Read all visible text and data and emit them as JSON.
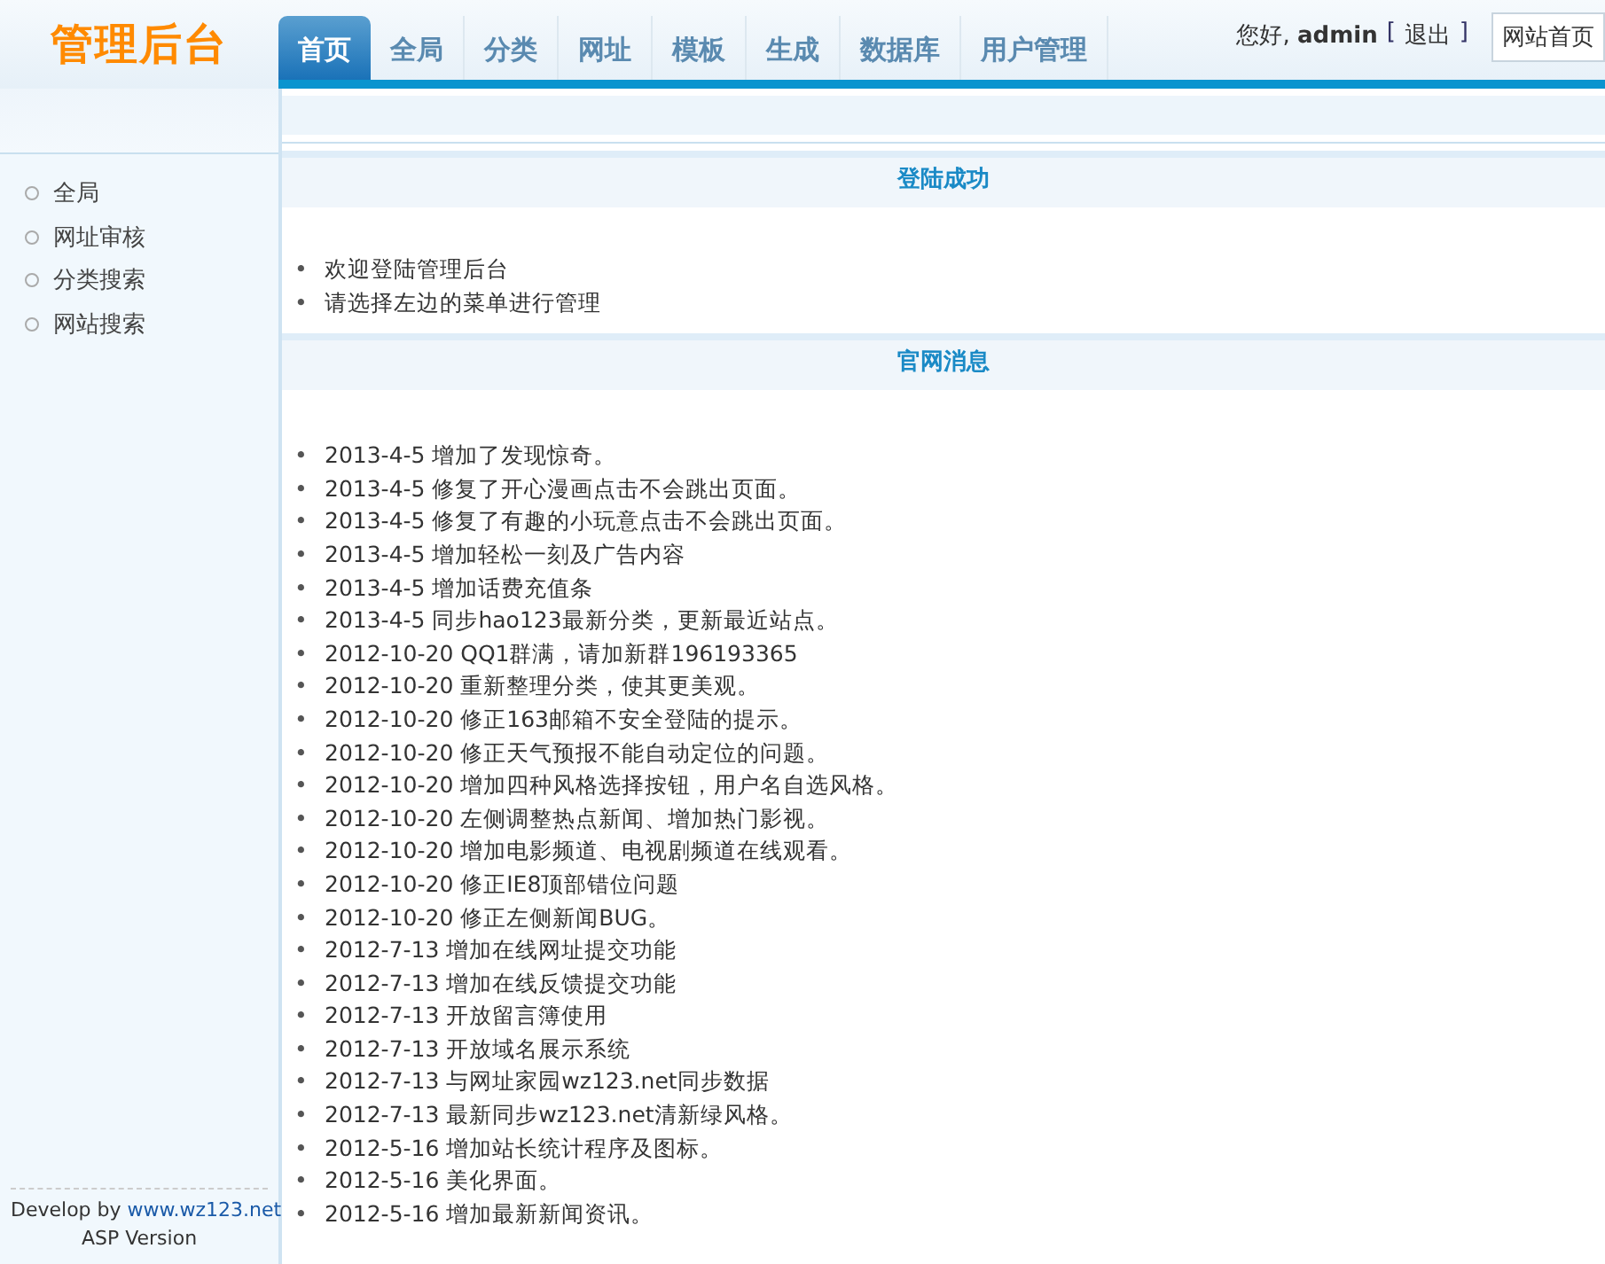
{
  "logo": "管理后台",
  "tabs": [
    {
      "label": "首页",
      "selected": true
    },
    {
      "label": "全局",
      "selected": false
    },
    {
      "label": "分类",
      "selected": false
    },
    {
      "label": "网址",
      "selected": false
    },
    {
      "label": "模板",
      "selected": false
    },
    {
      "label": "生成",
      "selected": false
    },
    {
      "label": "数据库",
      "selected": false
    },
    {
      "label": "用户管理",
      "selected": false
    }
  ],
  "user": {
    "greeting": "您好,",
    "name": "admin",
    "logout_open": "[",
    "logout": "退出",
    "logout_close": "]",
    "home_button": "网站首页"
  },
  "sidebar": {
    "items": [
      "全局",
      "网址审核",
      "分类搜索",
      "网站搜索"
    ],
    "footer": {
      "develop_by": "Develop by",
      "link": "www.wz123.net",
      "version": "ASP Version"
    }
  },
  "bullet": "•",
  "sections": [
    {
      "title": "登陆成功",
      "items": [
        "欢迎登陆管理后台",
        "请选择左边的菜单进行管理"
      ]
    },
    {
      "title": "官网消息",
      "items": [
        "2013-4-5 增加了发现惊奇。",
        "2013-4-5 修复了开心漫画点击不会跳出页面。",
        "2013-4-5 修复了有趣的小玩意点击不会跳出页面。",
        "2013-4-5 增加轻松一刻及广告内容",
        "2013-4-5 增加话费充值条",
        "2013-4-5 同步hao123最新分类，更新最近站点。",
        "2012-10-20 QQ1群满，请加新群196193365",
        "2012-10-20 重新整理分类，使其更美观。",
        "2012-10-20 修正163邮箱不安全登陆的提示。",
        "2012-10-20 修正天气预报不能自动定位的问题。",
        "2012-10-20 增加四种风格选择按钮，用户名自选风格。",
        "2012-10-20 左侧调整热点新闻、增加热门影视。",
        "2012-10-20 增加电影频道、电视剧频道在线观看。",
        "2012-10-20 修正IE8顶部错位问题",
        "2012-10-20 修正左侧新闻BUG。",
        "2012-7-13 增加在线网址提交功能",
        "2012-7-13 增加在线反馈提交功能",
        "2012-7-13 开放留言簿使用",
        "2012-7-13 开放域名展示系统",
        "2012-7-13 与网址家园wz123.net同步数据",
        "2012-7-13 最新同步wz123.net清新绿风格。",
        "2012-5-16 增加站长统计程序及图标。",
        "2012-5-16 美化界面。",
        "2012-5-16 增加最新新闻资讯。"
      ]
    }
  ]
}
